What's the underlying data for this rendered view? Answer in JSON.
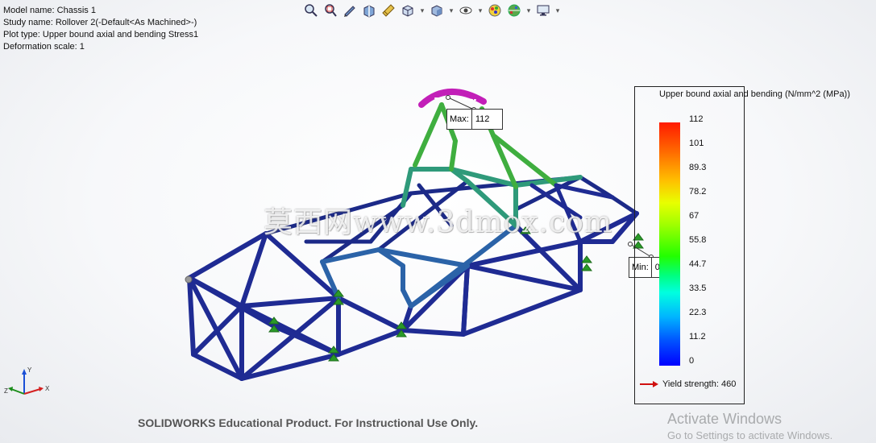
{
  "info": {
    "model": "Model name: Chassis 1",
    "study": "Study name: Rollover 2(-Default<As Machined>-)",
    "plot": "Plot type: Upper bound axial and bending Stress1",
    "scale": "Deformation scale: 1"
  },
  "toolbar": {
    "icons": [
      "zoom-to-fit-icon",
      "zoom-area-icon",
      "previous-view-icon",
      "section-view-icon",
      "view-settings-icon",
      "view-orientation-icon",
      "display-style-icon",
      "hide-show-icon",
      "appearance-icon",
      "scene-icon",
      "display-settings-icon"
    ]
  },
  "legend": {
    "title": "Upper bound axial and bending (N/mm^2 (MPa))",
    "ticks": [
      "112",
      "101",
      "89.3",
      "78.2",
      "67",
      "55.8",
      "44.7",
      "33.5",
      "22.3",
      "11.2",
      "0"
    ],
    "yield_label": "Yield strength: 460",
    "yield_color": "#d01010",
    "max_color": "#ff1a00",
    "min_color": "#0000ff"
  },
  "callouts": {
    "max_key": "Max:",
    "max_value": "112",
    "min_key": "Min:",
    "min_value": "0"
  },
  "triad": {
    "y": "Y",
    "x": "X",
    "z": "Z"
  },
  "watermark": "莫西网www.3dmox.com",
  "footer": "SOLIDWORKS Educational Product. For Instructional Use Only.",
  "activation": {
    "title": "Activate Windows",
    "subtitle": "Go to Settings to activate Windows."
  }
}
